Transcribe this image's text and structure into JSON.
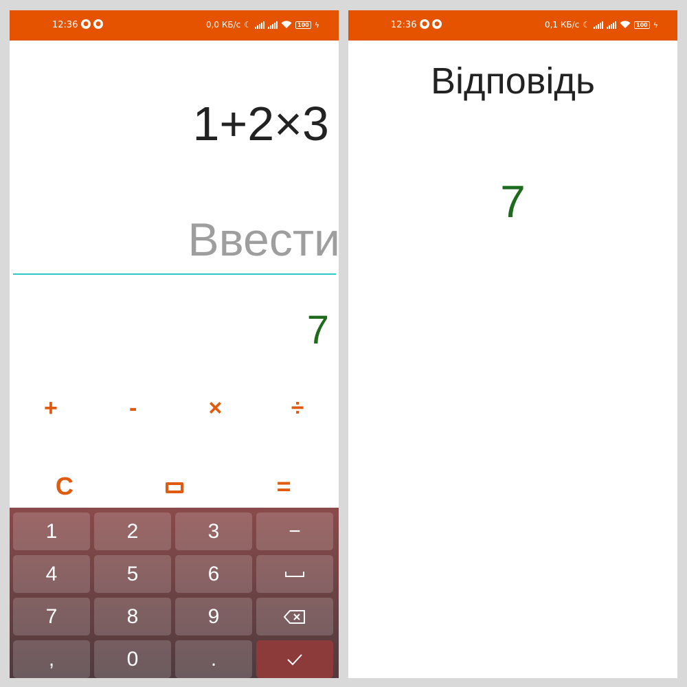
{
  "left_screen": {
    "status_bar": {
      "time": "12:36",
      "speed": "0,0 КБ/с",
      "battery": "100"
    },
    "expression": "1+2×3",
    "input_placeholder": "Ввести",
    "result": "7",
    "operators": [
      "+",
      "-",
      "×",
      "÷"
    ],
    "actions": [
      "C",
      "▭",
      "="
    ],
    "keyboard": {
      "keys": [
        "1",
        "2",
        "3",
        "−",
        "4",
        "5",
        "6",
        "␣",
        "7",
        "8",
        "9",
        "⌫",
        ",",
        "0",
        ".",
        "✓"
      ]
    }
  },
  "right_screen": {
    "status_bar": {
      "time": "12:36",
      "speed": "0,1 КБ/с",
      "battery": "100"
    },
    "title": "Відповідь",
    "answer": "7"
  },
  "colors": {
    "status_bar": "#e55200",
    "accent_orange": "#e05a10",
    "result_green": "#1e6b1e",
    "input_underline": "#2cc7c7",
    "keyboard_top": "#8a4a4a",
    "keyboard_bottom": "#4e3a3e"
  },
  "icons": {
    "status_left": [
      "moon-icon",
      "signal-icon",
      "signal-icon",
      "wifi-icon",
      "battery-icon",
      "charging-icon"
    ],
    "backspace": "backspace-icon",
    "confirm": "check-icon",
    "space": "space-icon"
  }
}
